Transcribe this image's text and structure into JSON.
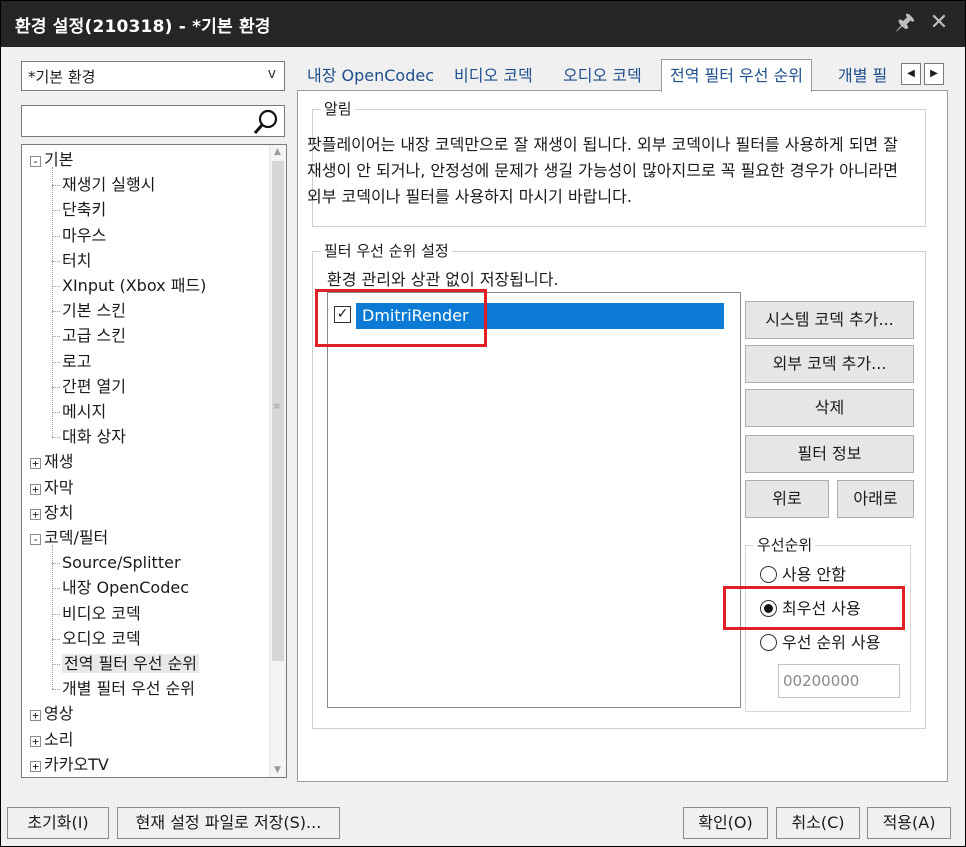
{
  "window": {
    "title": "환경 설정(210318) - *기본 환경"
  },
  "left": {
    "preset": "*기본 환경",
    "search_value": "",
    "tree": [
      {
        "label": "기본",
        "level": 0,
        "expanded": true
      },
      {
        "label": "재생기 실행시",
        "level": 1
      },
      {
        "label": "단축키",
        "level": 1
      },
      {
        "label": "마우스",
        "level": 1
      },
      {
        "label": "터치",
        "level": 1
      },
      {
        "label": "XInput (Xbox 패드)",
        "level": 1
      },
      {
        "label": "기본 스킨",
        "level": 1
      },
      {
        "label": "고급 스킨",
        "level": 1
      },
      {
        "label": "로고",
        "level": 1
      },
      {
        "label": "간편 열기",
        "level": 1
      },
      {
        "label": "메시지",
        "level": 1
      },
      {
        "label": "대화 상자",
        "level": 1
      },
      {
        "label": "재생",
        "level": 0,
        "expanded": false
      },
      {
        "label": "자막",
        "level": 0,
        "expanded": false
      },
      {
        "label": "장치",
        "level": 0,
        "expanded": false
      },
      {
        "label": "코덱/필터",
        "level": 0,
        "expanded": true
      },
      {
        "label": "Source/Splitter",
        "level": 1
      },
      {
        "label": "내장 OpenCodec",
        "level": 1
      },
      {
        "label": "비디오 코덱",
        "level": 1
      },
      {
        "label": "오디오 코덱",
        "level": 1
      },
      {
        "label": "전역 필터 우선 순위",
        "level": 1,
        "selected": true
      },
      {
        "label": "개별 필터 우선 순위",
        "level": 1
      },
      {
        "label": "영상",
        "level": 0,
        "expanded": false
      },
      {
        "label": "소리",
        "level": 0,
        "expanded": false
      },
      {
        "label": "카카오TV",
        "level": 0,
        "expanded": false
      }
    ]
  },
  "tabs": [
    {
      "label": "내장 OpenCodec"
    },
    {
      "label": "비디오 코덱"
    },
    {
      "label": "오디오 코덱"
    },
    {
      "label": "전역 필터 우선 순위",
      "active": true
    },
    {
      "label": "개별 필"
    }
  ],
  "notice": {
    "title": "알림",
    "text": "팟플레이어는 내장 코덱만으로 잘 재생이 됩니다. 외부 코덱이나 필터를 사용하게 되면 잘 재생이 안 되거나, 안정성에 문제가 생길 가능성이 많아지므로 꼭 필요한 경우가 아니라면 외부 코덱이나 필터를 사용하지 마시기 바랍니다."
  },
  "filter": {
    "title": "필터 우선 순위 설정",
    "note": "환경 관리와 상관 없이 저장됩니다.",
    "items": [
      {
        "label": "DmitriRender",
        "checked": true
      }
    ],
    "buttons": {
      "add_system": "시스템 코덱 추가...",
      "add_external": "외부 코덱 추가...",
      "delete": "삭제",
      "info": "필터 정보",
      "up": "위로",
      "down": "아래로"
    },
    "priority": {
      "title": "우선순위",
      "options": [
        "사용 안함",
        "최우선 사용",
        "우선 순위 사용"
      ],
      "selected_index": 1,
      "value": "00200000"
    }
  },
  "bottom": {
    "reset": "초기화(I)",
    "save_to_file": "현재 설정 파일로 저장(S)...",
    "ok": "확인(O)",
    "cancel": "취소(C)",
    "apply": "적용(A)"
  },
  "colors": {
    "titlebar": "#262626",
    "selection": "#0a7ad4",
    "tab_text": "#1e4f8c",
    "highlight_box": "#e11f26"
  }
}
